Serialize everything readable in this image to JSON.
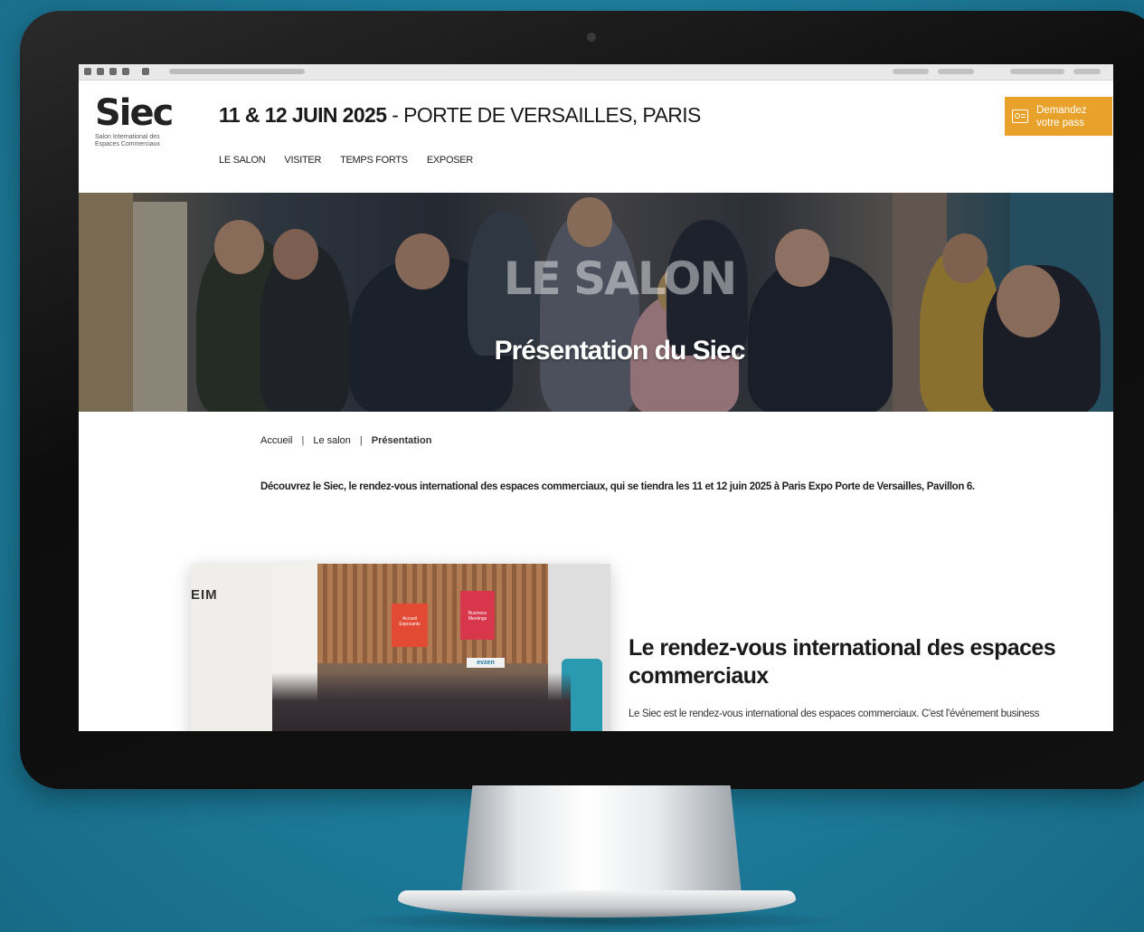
{
  "site": {
    "logo_word": "Siec",
    "logo_tagline": "Salon International des Espaces Commerciaux"
  },
  "header": {
    "dates": "11 & 12 JUIN 2025",
    "location": " - PORTE DE VERSAILLES, PARIS",
    "nav": [
      "LE SALON",
      "VISITER",
      "TEMPS FORTS",
      "EXPOSER"
    ],
    "cta_label": "Demandez votre pass",
    "cta_color": "#e8a22b"
  },
  "hero": {
    "kicker": "LE SALON",
    "title": "Présentation du Siec"
  },
  "breadcrumb": {
    "items": [
      "Accueil",
      "Le salon",
      "Présentation"
    ],
    "separator": "|"
  },
  "intro": "Découvrez le Siec, le rendez-vous international des espaces commerciaux, qui se tiendra les 11 et 12 juin 2025 à Paris Expo Porte de Versailles, Pavillon 6.",
  "section": {
    "title": "Le rendez-vous international des espaces commerciaux",
    "body": "Le Siec est le rendez-vous international des espaces commerciaux. C'est l'événement business"
  },
  "photo": {
    "signs": [
      "EIM",
      "Accueil Exposants",
      "Business Meetings",
      "evzen"
    ]
  },
  "colors": {
    "background": "#1f7f9f",
    "accent": "#e8a22b"
  }
}
